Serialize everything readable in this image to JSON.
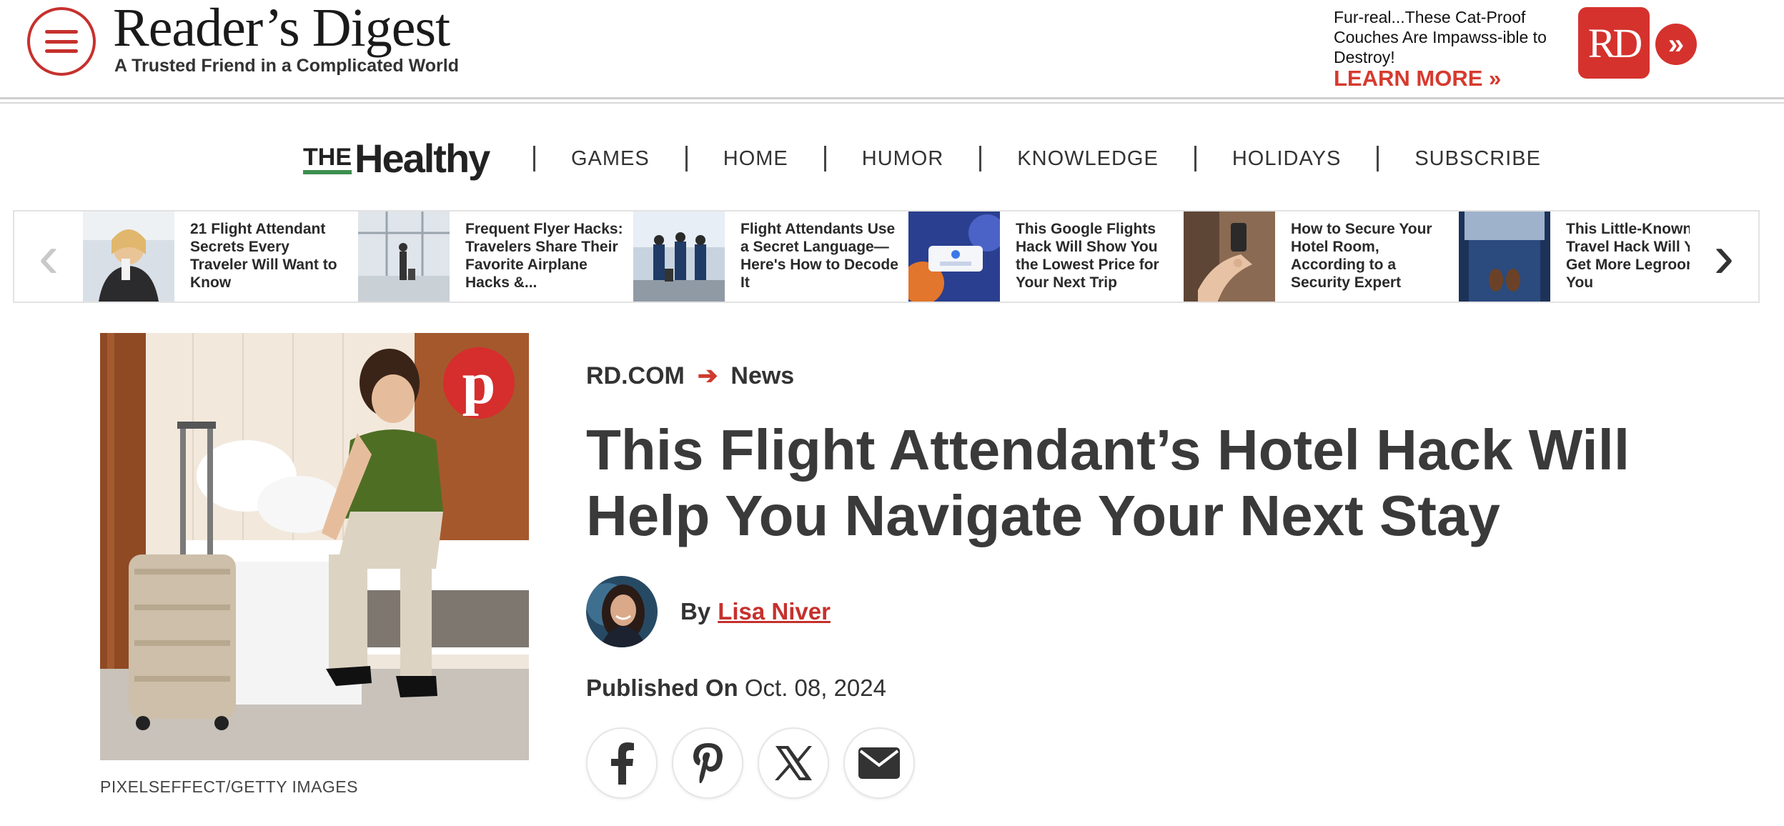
{
  "header": {
    "brand_title": "Reader’s Digest",
    "brand_tagline": "A Trusted Friend in a Complicated World",
    "ad": {
      "text": "Fur-real...These Cat-Proof Couches Are Impawss-ible to Destroy!",
      "cta": "LEARN MORE »",
      "logo_text": "RD",
      "arrow_glyph": "»"
    }
  },
  "section_nav": {
    "logo_the": "THE",
    "logo_word": "Healthy",
    "links": [
      "GAMES",
      "HOME",
      "HUMOR",
      "KNOWLEDGE",
      "HOLIDAYS",
      "SUBSCRIBE"
    ]
  },
  "carousel": {
    "prev_glyph": "‹",
    "next_glyph": "›",
    "items": [
      {
        "title": "21 Flight Attendant Secrets Every Traveler Will Want to Know"
      },
      {
        "title": "Frequent Flyer Hacks: Travelers Share Their Favorite Airplane Hacks &..."
      },
      {
        "title": "Flight Attendants Use a Secret Language—Here's How to Decode It"
      },
      {
        "title": "This Google Flights Hack Will Show You the Lowest Price for Your Next Trip"
      },
      {
        "title": "How to Secure Your Hotel Room, According to a Security Expert"
      },
      {
        "title": "This Little-Known Travel Hack Will You Get More Legroom on You"
      }
    ]
  },
  "article": {
    "image_credit": "PIXELSEFFECT/GETTY IMAGES",
    "breadcrumb": [
      "RD.COM",
      "News"
    ],
    "breadcrumb_arrow": "➔",
    "headline": "This Flight Attendant’s Hotel Hack Will Help You Navigate Your Next Stay",
    "by_label": "By",
    "author": "Lisa Niver",
    "published_label": "Published On",
    "published_date": "Oct. 08, 2024",
    "pin_glyph": "p"
  },
  "colors": {
    "brand_red": "#c6312d",
    "healthy_green": "#3d8e4f",
    "text_dark": "#3a3a3a"
  },
  "icons": [
    "hamburger-menu-icon",
    "pinterest-icon",
    "facebook-icon",
    "x-icon",
    "email-icon",
    "chevron-left-icon",
    "chevron-right-icon"
  ]
}
